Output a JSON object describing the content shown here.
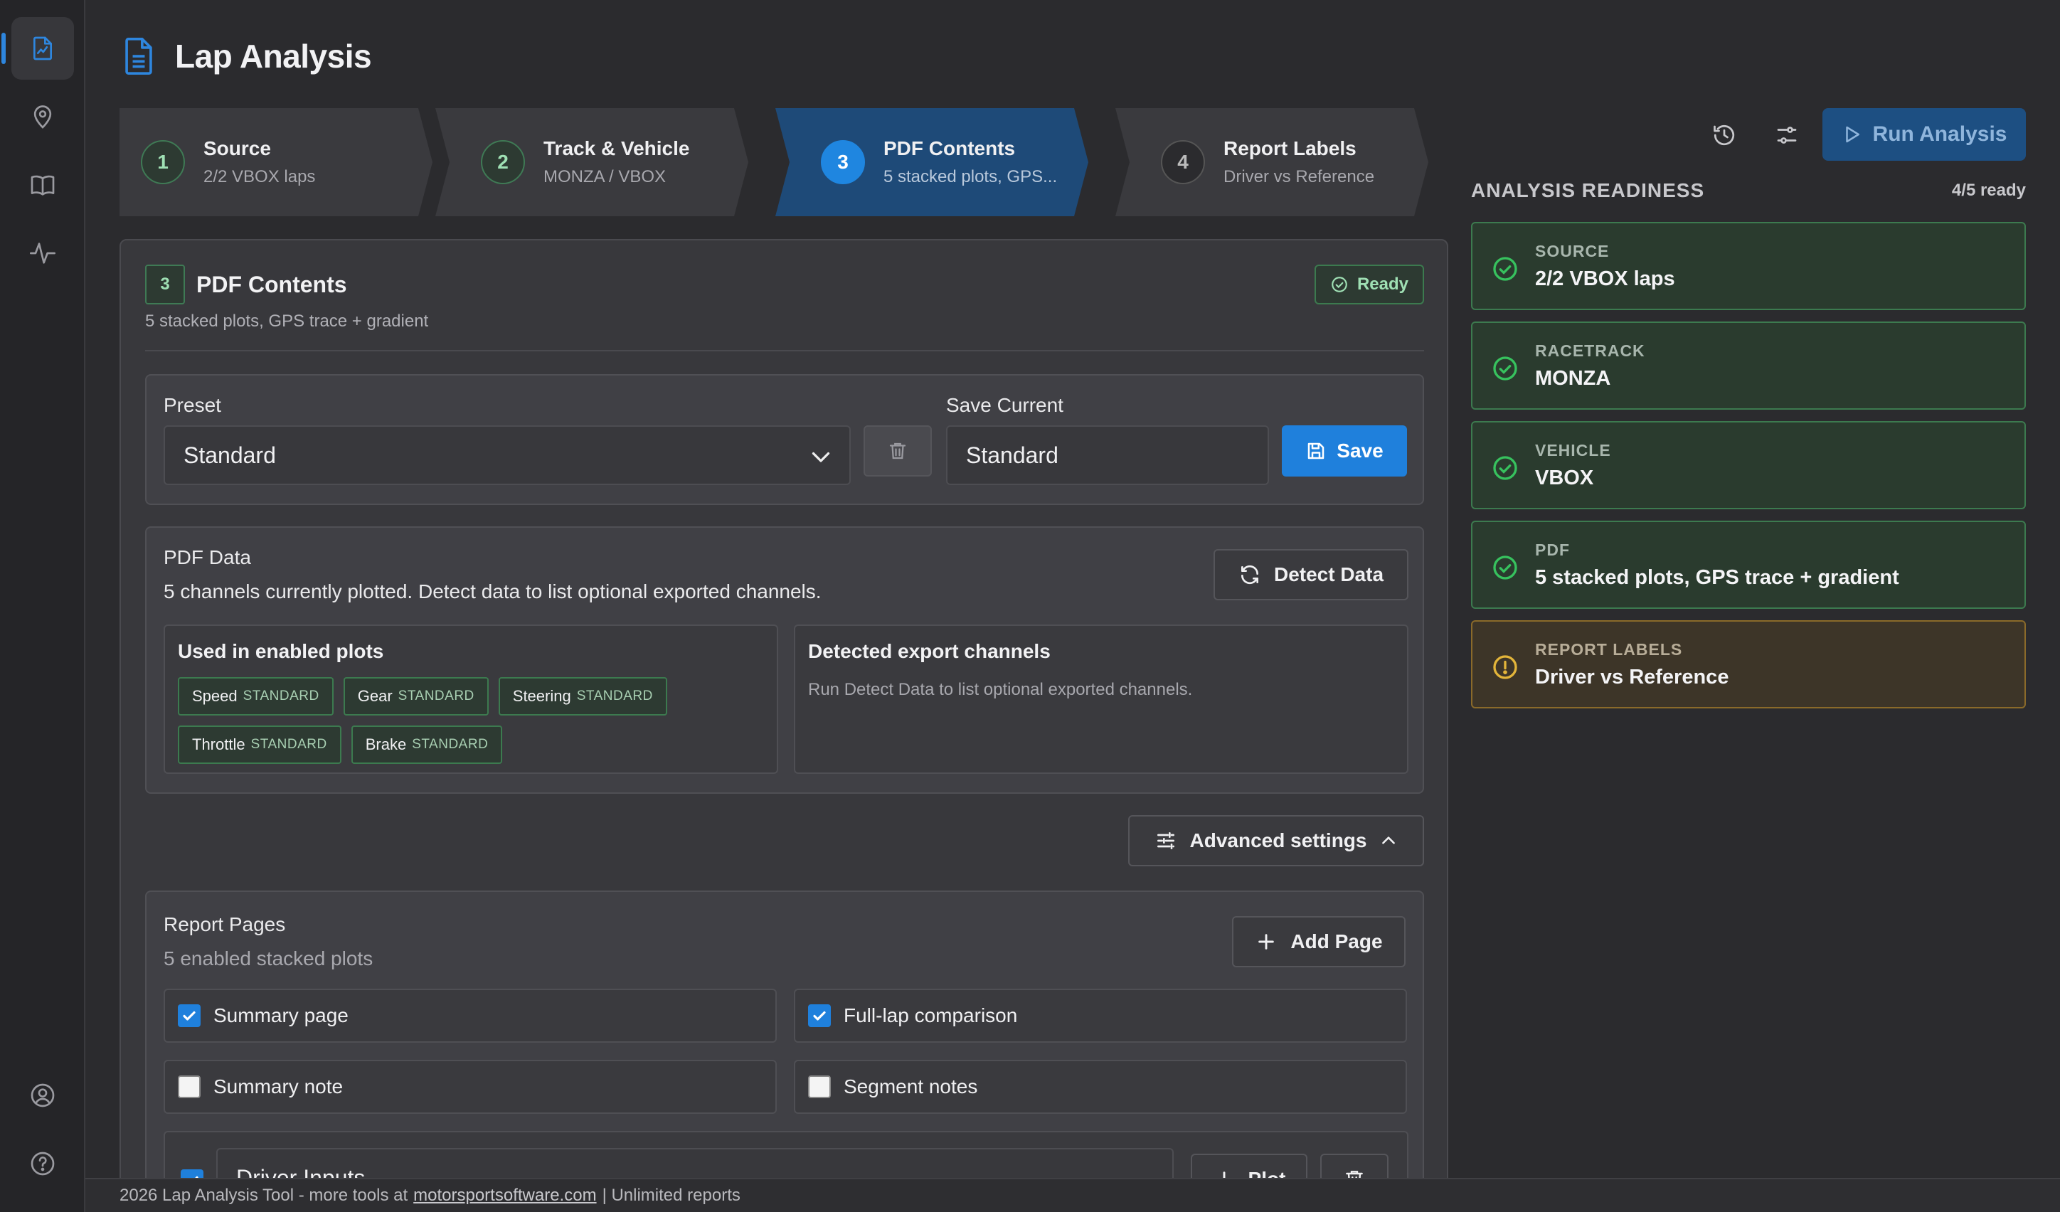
{
  "app": {
    "title": "Lap Analysis"
  },
  "rail": {
    "items": [
      "report-icon",
      "location-pin-icon",
      "book-icon",
      "activity-icon"
    ],
    "bottom": [
      "user-icon",
      "help-icon"
    ]
  },
  "stepper": [
    {
      "num": "1",
      "title": "Source",
      "sub": "2/2 VBOX laps",
      "state": "done"
    },
    {
      "num": "2",
      "title": "Track & Vehicle",
      "sub": "MONZA / VBOX",
      "state": "done"
    },
    {
      "num": "3",
      "title": "PDF Contents",
      "sub": "5 stacked plots, GPS...",
      "state": "active"
    },
    {
      "num": "4",
      "title": "Report Labels",
      "sub": "Driver vs Reference",
      "state": "pending"
    }
  ],
  "toolbar": {
    "run_label": "Run Analysis"
  },
  "section": {
    "num": "3",
    "title": "PDF Contents",
    "subtitle": "5 stacked plots, GPS trace + gradient",
    "status": "Ready"
  },
  "preset": {
    "label": "Preset",
    "value": "Standard",
    "save_label": "Save Current",
    "save_value": "Standard",
    "save_button": "Save"
  },
  "pdf_data": {
    "title": "PDF Data",
    "description": "5 channels currently plotted. Detect data to list optional exported channels.",
    "detect_button": "Detect Data",
    "used_title": "Used in enabled plots",
    "chips": [
      {
        "name": "Speed",
        "tag": "STANDARD"
      },
      {
        "name": "Gear",
        "tag": "STANDARD"
      },
      {
        "name": "Steering",
        "tag": "STANDARD"
      },
      {
        "name": "Throttle",
        "tag": "STANDARD"
      },
      {
        "name": "Brake",
        "tag": "STANDARD"
      }
    ],
    "detected_title": "Detected export channels",
    "detected_msg": "Run Detect Data to list optional exported channels."
  },
  "advanced": {
    "label": "Advanced settings"
  },
  "report_pages": {
    "title": "Report Pages",
    "subtitle": "5 enabled stacked plots",
    "add_button": "Add Page",
    "options": [
      {
        "label": "Summary page",
        "checked": true
      },
      {
        "label": "Full-lap comparison",
        "checked": true
      },
      {
        "label": "Summary note",
        "checked": false
      },
      {
        "label": "Segment notes",
        "checked": false
      }
    ],
    "plot_row": {
      "name": "Driver Inputs",
      "plot_button": "Plot"
    }
  },
  "readiness": {
    "title": "ANALYSIS READINESS",
    "count": "4/5 ready",
    "items": [
      {
        "key": "SOURCE",
        "value": "2/2 VBOX laps",
        "status": "ok"
      },
      {
        "key": "RACETRACK",
        "value": "MONZA",
        "status": "ok"
      },
      {
        "key": "VEHICLE",
        "value": "VBOX",
        "status": "ok"
      },
      {
        "key": "PDF",
        "value": "5 stacked plots, GPS trace + gradient",
        "status": "ok"
      },
      {
        "key": "REPORT LABELS",
        "value": "Driver vs Reference",
        "status": "warn"
      }
    ]
  },
  "footer": {
    "prefix": "2026 Lap Analysis Tool - more tools at",
    "link": "motorsportsoftware.com",
    "suffix": "| Unlimited reports"
  },
  "colors": {
    "accent": "#1f80dc",
    "ok": "#3c7a4f",
    "warn": "#e3b53a",
    "bg": "#2b2b2e"
  }
}
